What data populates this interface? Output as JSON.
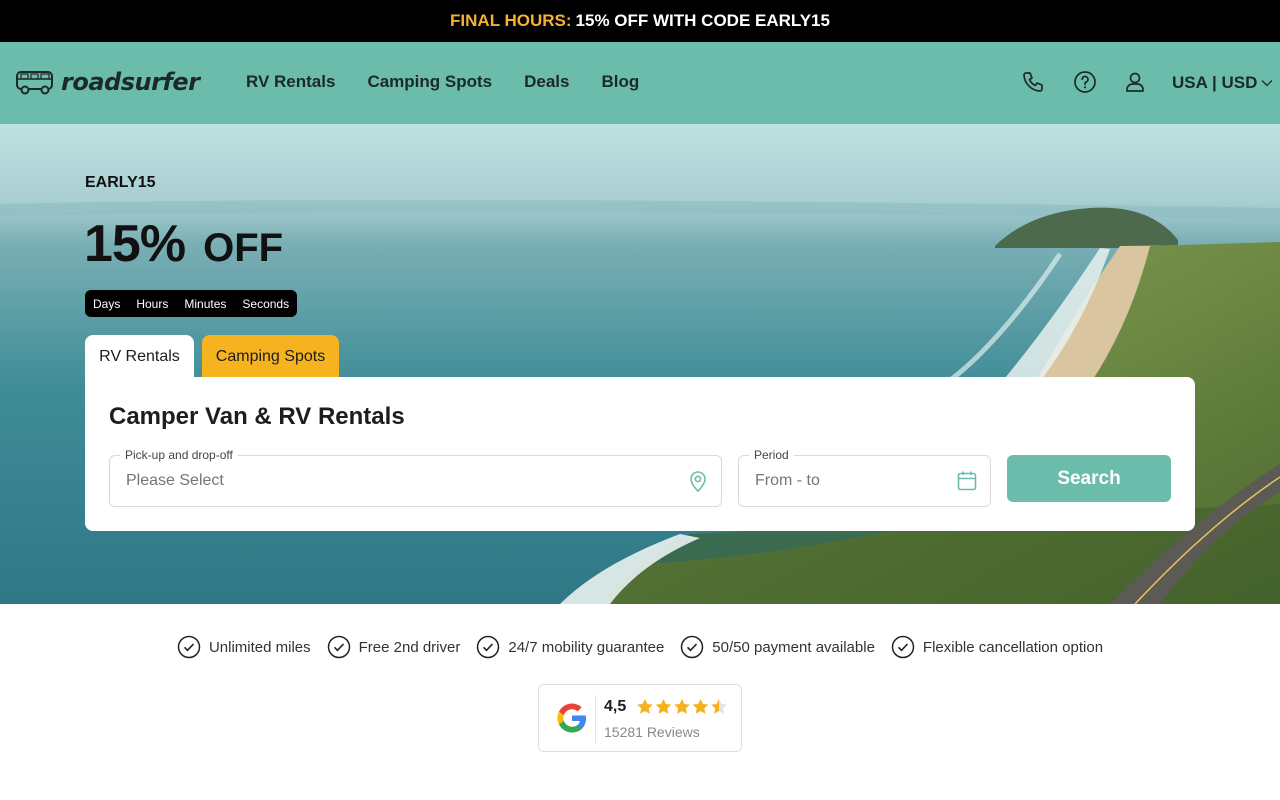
{
  "promo": {
    "highlight": "FINAL HOURS:",
    "text": "15% OFF WITH CODE EARLY15"
  },
  "header": {
    "logo_text": "roadsurfer",
    "nav": [
      "RV Rentals",
      "Camping Spots",
      "Deals",
      "Blog"
    ],
    "icons": [
      "phone-icon",
      "help-icon",
      "user-icon"
    ],
    "locale": "USA | USD"
  },
  "hero": {
    "code": "EARLY15",
    "discount": "15%",
    "discount_suffix": "OFF",
    "countdown": [
      "Days",
      "Hours",
      "Minutes",
      "Seconds"
    ]
  },
  "tabs": {
    "rv": "RV Rentals",
    "camping": "Camping Spots"
  },
  "search": {
    "title": "Camper Van & RV Rentals",
    "location_label": "Pick-up and drop-off",
    "location_placeholder": "Please Select",
    "period_label": "Period",
    "period_placeholder": "From - to",
    "button": "Search"
  },
  "usps": [
    "Unlimited miles",
    "Free 2nd driver",
    "24/7 mobility guarantee",
    "50/50 payment available",
    "Flexible cancellation option"
  ],
  "reviews": {
    "rating": "4,5",
    "stars": 4.5,
    "count": "15281 Reviews"
  },
  "colors": {
    "brand": "#6cbcac",
    "accent": "#f7b21f",
    "promo_highlight": "#f5b231"
  }
}
